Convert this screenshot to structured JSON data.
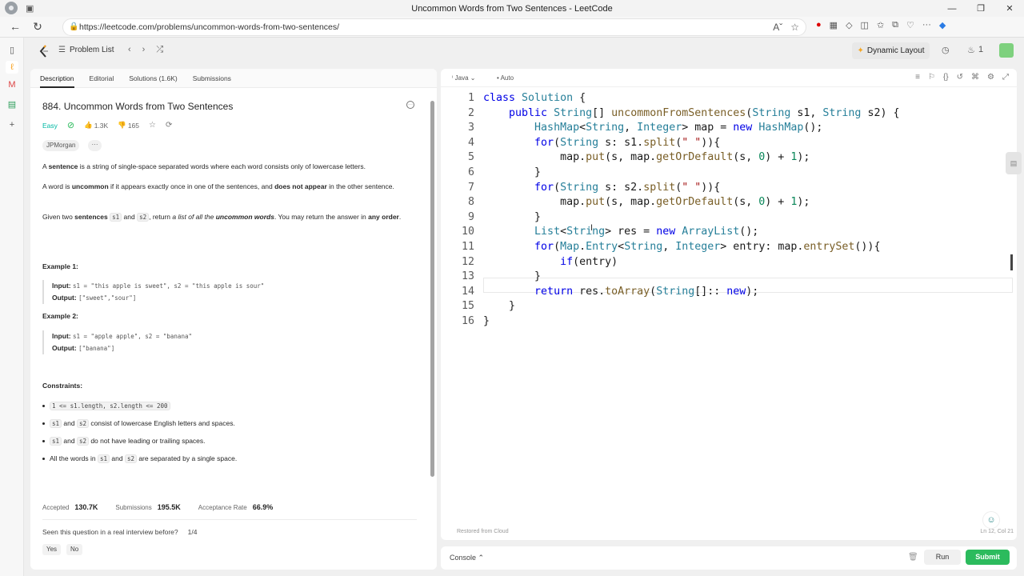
{
  "browser": {
    "window_title": "Uncommon Words from Two Sentences - LeetCode",
    "url": "https://leetcode.com/problems/uncommon-words-from-two-sentences/"
  },
  "nav": {
    "problem_list": "Problem List",
    "dynamic_layout": "Dynamic Layout",
    "streak": "1"
  },
  "tabs": [
    "Description",
    "Editorial",
    "Solutions (1.6K)",
    "Submissions"
  ],
  "problem": {
    "title": "884. Uncommon Words from Two Sentences",
    "difficulty": "Easy",
    "likes": "1.3K",
    "dislikes": "165",
    "company_tag": "JPMorgan",
    "more_tag": "···",
    "p1_bold": "sentence",
    "p1_rest": " is a string of single-space separated words where each word consists only of lowercase letters.",
    "p2_a": "A word is ",
    "p2_b": "uncommon",
    "p2_c": " if it appears exactly once in one of the sentences, and ",
    "p2_d": "does not appear",
    "p2_e": " in the other sentence.",
    "p3_a": "Given two ",
    "p3_b": "sentences",
    "p3_c": "s1",
    "p3_d": " and ",
    "p3_e": "s2",
    "p3_f": ", return ",
    "p3_g": "a list of all the ",
    "p3_h": "uncommon words",
    "p3_i": ". You may return the answer in ",
    "p3_j": "any order",
    "p3_k": ".",
    "ex1_head": "Example 1:",
    "ex1_input_label": "Input:",
    "ex1_input": "s1 = \"this apple is sweet\", s2 = \"this apple is sour\"",
    "ex1_output_label": "Output:",
    "ex1_output": "[\"sweet\",\"sour\"]",
    "ex2_head": "Example 2:",
    "ex2_input_label": "Input:",
    "ex2_input": "s1 = \"apple apple\", s2 = \"banana\"",
    "ex2_output_label": "Output:",
    "ex2_output": "[\"banana\"]",
    "constraints_head": "Constraints:",
    "c1": "1 <= s1.length, s2.length <= 200",
    "c2_code1": "s1",
    "c2_and": " and ",
    "c2_code2": "s2",
    "c2_rest": " consist of lowercase English letters and spaces.",
    "c3_code1": "s1",
    "c3_and": " and ",
    "c3_code2": "s2",
    "c3_rest": " do not have leading or trailing spaces.",
    "c4_a": "All the words in ",
    "c4_code1": "s1",
    "c4_and": " and ",
    "c4_code2": "s2",
    "c4_rest": " are separated by a single space.",
    "accepted_label": "Accepted",
    "accepted": "130.7K",
    "submissions_label": "Submissions",
    "submissions": "195.5K",
    "rate_label": "Acceptance Rate",
    "rate": "66.9%",
    "seen_q": "Seen this question in a real interview before?",
    "seen_frac": "1/4",
    "yes": "Yes",
    "no": "No"
  },
  "editor": {
    "language": "Java",
    "auto": "Auto",
    "restored": "Restored from Cloud",
    "cursor_pos": "Ln 12, Col 21"
  },
  "console": {
    "label": "Console",
    "run": "Run",
    "submit": "Submit"
  },
  "colors": {
    "easy": "#00b8a3",
    "submit": "#2cbb5d",
    "keyword": "#0000e6",
    "type": "#267f99"
  }
}
